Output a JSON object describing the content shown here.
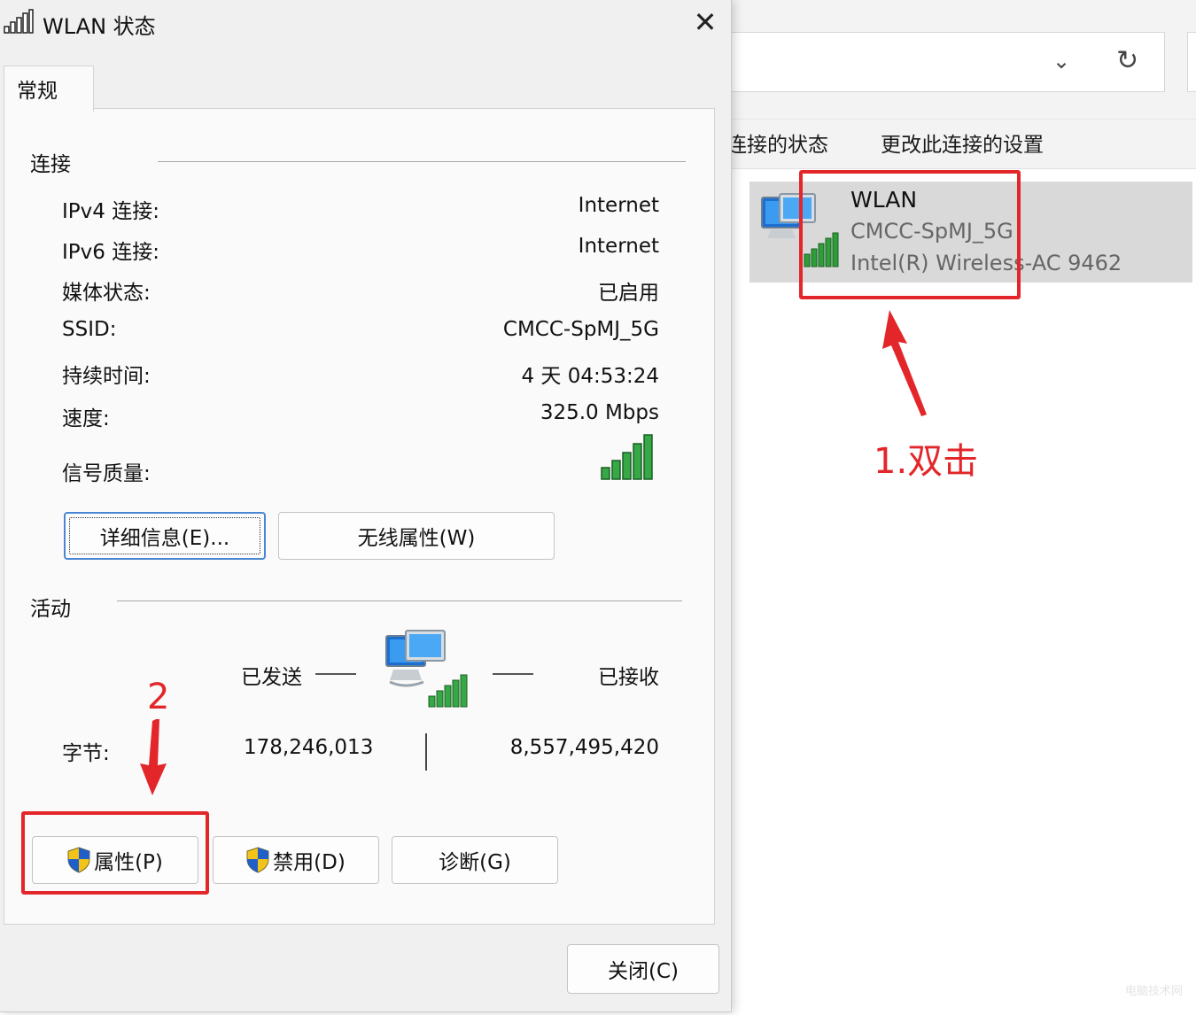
{
  "explorer": {
    "toolbar": {
      "cmd_status": "连接的状态",
      "cmd_settings": "更改此连接的设置"
    },
    "icons": {
      "dropdown": "chevron-down-icon",
      "refresh": "refresh-icon"
    },
    "connection": {
      "name": "WLAN",
      "ssid": "CMCC-SpMJ_5G",
      "device": "Intel(R) Wireless-AC 9462"
    }
  },
  "dialog": {
    "title": "WLAN 状态",
    "close_glyph": "✕",
    "tab": "常规",
    "connection_group": {
      "label": "连接",
      "rows": [
        {
          "label": "IPv4 连接:",
          "value": "Internet"
        },
        {
          "label": "IPv6 连接:",
          "value": "Internet"
        },
        {
          "label": "媒体状态:",
          "value": "已启用"
        },
        {
          "label": "SSID:",
          "value": "CMCC-SpMJ_5G"
        },
        {
          "label": "持续时间:",
          "value": "4 天 04:53:24"
        },
        {
          "label": "速度:",
          "value": "325.0 Mbps"
        }
      ],
      "signal_label": "信号质量:",
      "signal_bars": 5,
      "details_button": "详细信息(E)...",
      "wireless_button": "无线属性(W)"
    },
    "activity_group": {
      "label": "活动",
      "sent_label": "已发送",
      "received_label": "已接收",
      "bytes_label": "字节:",
      "bytes_sent": "178,246,013",
      "bytes_received": "8,557,495,420"
    },
    "buttons": {
      "properties": "属性(P)",
      "disable": "禁用(D)",
      "diagnose": "诊断(G)",
      "close": "关闭(C)"
    }
  },
  "annotations": {
    "step1": "1.双击",
    "step2": "2",
    "color": "#e3262a"
  },
  "watermark": "电脑技术网"
}
